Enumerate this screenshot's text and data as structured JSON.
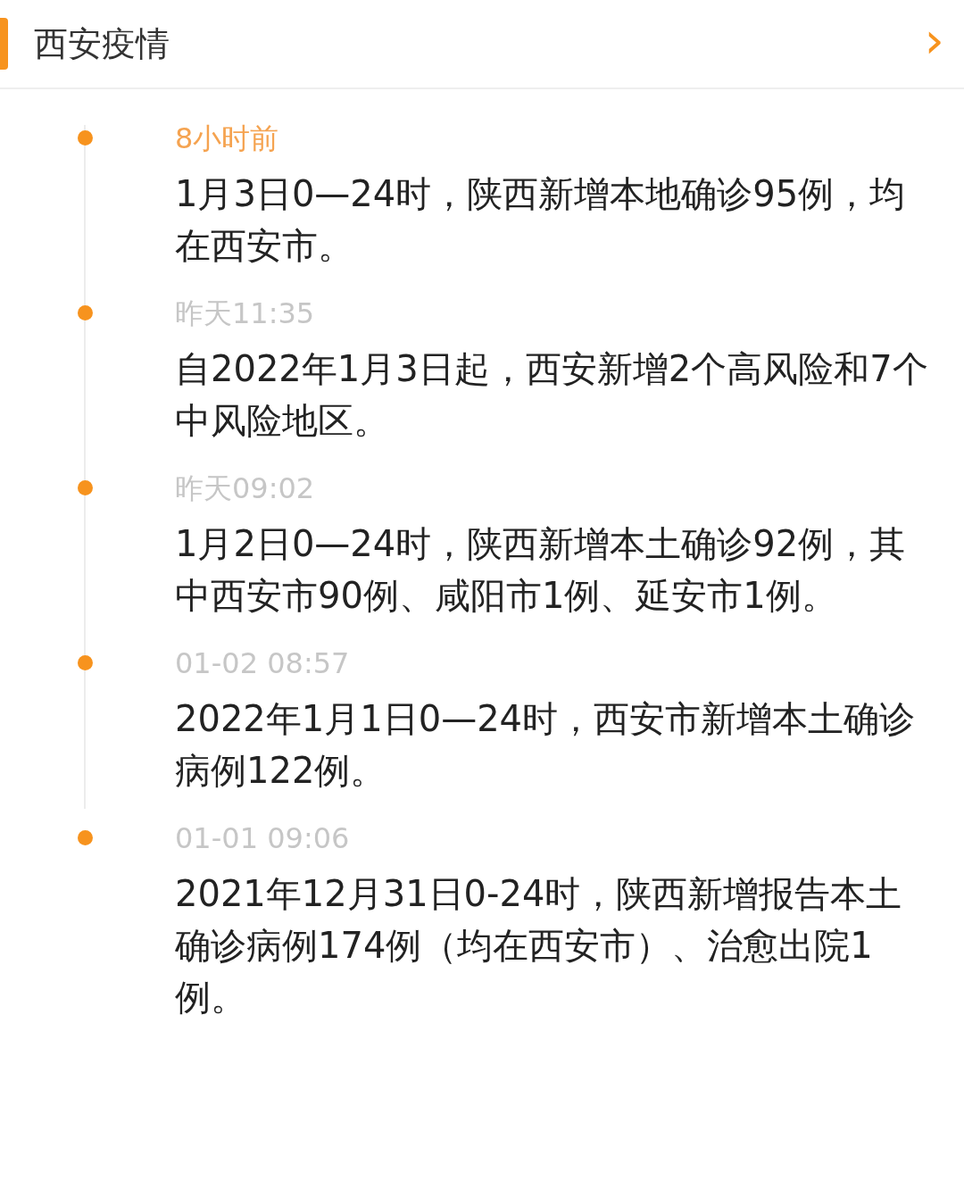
{
  "header": {
    "title": "西安疫情",
    "chevron": "›"
  },
  "timeline": [
    {
      "time": "8小时前",
      "highlighted": true,
      "text": "1月3日0—24时，陕西新增本地确诊95例，均在西安市。"
    },
    {
      "time": "昨天11:35",
      "highlighted": false,
      "text": "自2022年1月3日起，西安新增2个高风险和7个中风险地区。"
    },
    {
      "time": "昨天09:02",
      "highlighted": false,
      "text": "1月2日0—24时，陕西新增本土确诊92例，其中西安市90例、咸阳市1例、延安市1例。"
    },
    {
      "time": "01-02 08:57",
      "highlighted": false,
      "text": "2022年1月1日0—24时，西安市新增本土确诊病例122例。"
    },
    {
      "time": "01-01 09:06",
      "highlighted": false,
      "text": "2021年12月31日0-24时，陕西新增报告本土确诊病例174例（均在西安市）、治愈出院1例。"
    }
  ]
}
